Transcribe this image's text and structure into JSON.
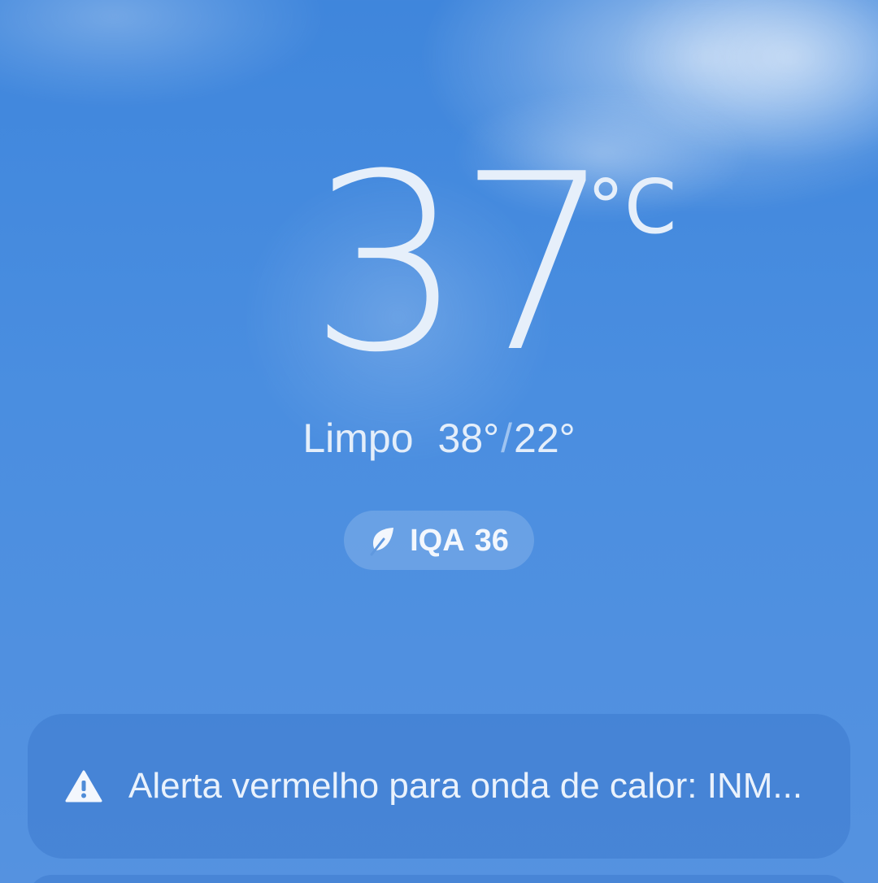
{
  "current": {
    "temperature": "37",
    "unit": "°C",
    "condition": "Limpo",
    "high": "38°",
    "low": "22°",
    "separator": "/"
  },
  "aqi": {
    "label": "IQA",
    "value": "36",
    "icon": "leaf-icon"
  },
  "alert": {
    "icon": "warning-icon",
    "text": "Alerta vermelho para onda de calor: INM..."
  },
  "colors": {
    "sky_top": "#3f86dc",
    "sky_bottom": "#5592e0",
    "text": "#e6effa"
  }
}
